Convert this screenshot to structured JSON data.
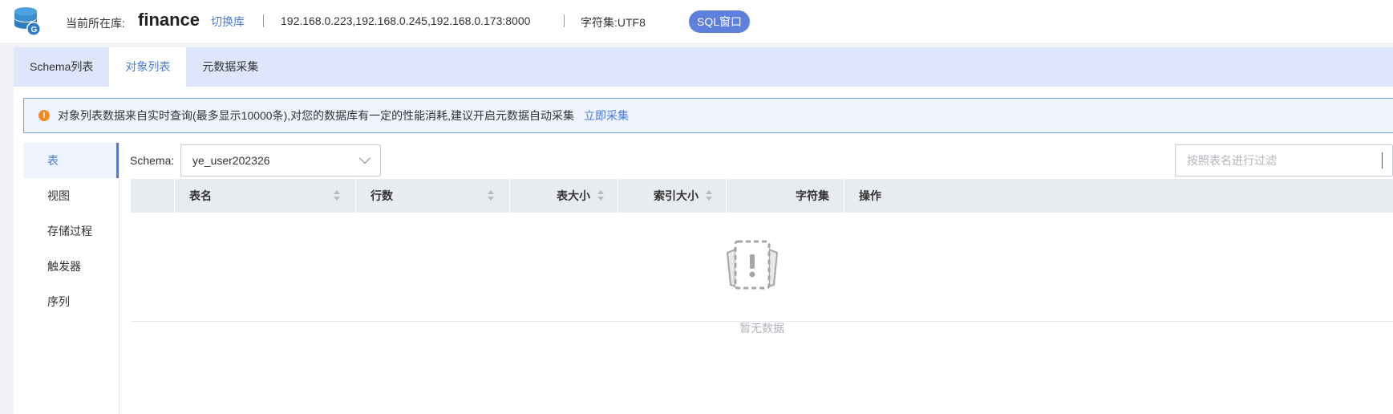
{
  "header": {
    "current_db_label": "当前所在库:",
    "db_name": "finance",
    "switch_label": "切换库",
    "hosts": "192.168.0.223,192.168.0.245,192.168.0.173:8000",
    "charset_label": "字符集:UTF8",
    "sql_button": "SQL窗口"
  },
  "tabs": [
    {
      "label": "Schema列表",
      "active": false
    },
    {
      "label": "对象列表",
      "active": true
    },
    {
      "label": "元数据采集",
      "active": false
    }
  ],
  "notice": {
    "icon": "warning-icon",
    "message": "对象列表数据来自实时查询(最多显示10000条),对您的数据库有一定的性能消耗,建议开启元数据自动采集",
    "action": "立即采集",
    "color": "#f08a24"
  },
  "sidebar": {
    "items": [
      {
        "label": "表",
        "active": true
      },
      {
        "label": "视图",
        "active": false
      },
      {
        "label": "存储过程",
        "active": false
      },
      {
        "label": "触发器",
        "active": false
      },
      {
        "label": "序列",
        "active": false
      }
    ]
  },
  "filters": {
    "schema_label": "Schema:",
    "schema_value": "ye_user202326",
    "search_placeholder": "按照表名进行过滤"
  },
  "table": {
    "columns": [
      "表名",
      "行数",
      "表大小",
      "索引大小",
      "字符集",
      "操作"
    ],
    "rows": [],
    "empty_text": "暂无数据"
  },
  "colors": {
    "accent": "#4a7bd8",
    "sql_button": "#5f7fdc",
    "tab_bar": "#dde6fb"
  }
}
